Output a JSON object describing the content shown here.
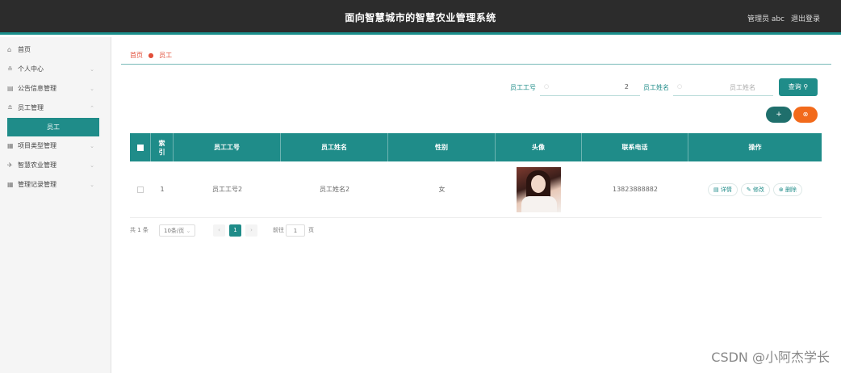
{
  "header": {
    "title": "面向智慧城市的智慧农业管理系统",
    "user": "管理员 abc",
    "logout": "退出登录"
  },
  "sidebar": {
    "items": [
      {
        "label": "首页",
        "icon": "home-icon"
      },
      {
        "label": "个人中心",
        "icon": "user-icon"
      },
      {
        "label": "公告信息管理",
        "icon": "notice-icon"
      },
      {
        "label": "员工管理",
        "icon": "user-icon"
      },
      {
        "label": "员工",
        "icon": "",
        "active": true
      },
      {
        "label": "项目类型管理",
        "icon": "list-icon"
      },
      {
        "label": "智慧农业管理",
        "icon": "send-icon"
      },
      {
        "label": "管理记录管理",
        "icon": "list-icon"
      }
    ]
  },
  "breadcrumb": {
    "home": "首页",
    "current": "员工"
  },
  "search": {
    "employee_no_label": "员工工号",
    "employee_no_value": "2",
    "employee_name_label": "员工姓名",
    "employee_name_placeholder": "员工姓名",
    "search_button": "查询"
  },
  "actions": {
    "add_button": "+",
    "delete_button": "⊗"
  },
  "table": {
    "columns": [
      "索引",
      "员工工号",
      "员工姓名",
      "性别",
      "头像",
      "联系电话",
      "操作"
    ],
    "rows": [
      {
        "index": "1",
        "employee_no": "员工工号2",
        "employee_name": "员工姓名2",
        "gender": "女",
        "phone": "13823888882",
        "ops": [
          "详情",
          "修改",
          "删除"
        ]
      }
    ]
  },
  "pagination": {
    "total": "共 1 条",
    "page_size": "10条/页",
    "current_page": "1",
    "goto_label": "前往",
    "goto_value": "1",
    "page_unit": "页"
  },
  "watermark": "CSDN @小阿杰学长",
  "colors": {
    "accent": "#1f8c89",
    "danger": "#f26a1b",
    "topbar": "#2c2c2c"
  }
}
